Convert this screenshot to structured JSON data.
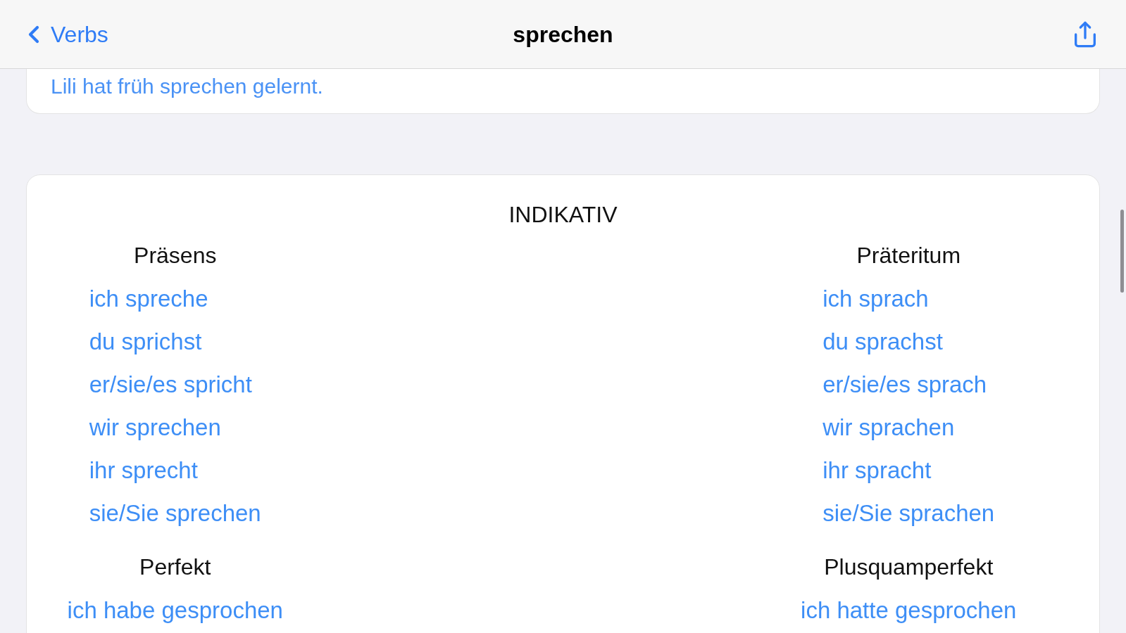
{
  "nav": {
    "back": "Verbs",
    "title": "sprechen"
  },
  "example": "Lili hat früh sprechen gelernt.",
  "section": {
    "title": "INDIKATIV",
    "columns": [
      {
        "groups": [
          {
            "title": "Präsens",
            "forms": [
              "ich spreche",
              "du sprichst",
              "er/sie/es spricht",
              "wir sprechen",
              "ihr sprecht",
              "sie/Sie sprechen"
            ]
          },
          {
            "title": "Perfekt",
            "forms": [
              "ich habe gesprochen"
            ]
          }
        ]
      },
      {
        "groups": [
          {
            "title": "Präteritum",
            "forms": [
              "ich sprach",
              "du sprachst",
              "er/sie/es sprach",
              "wir sprachen",
              "ihr spracht",
              "sie/Sie sprachen"
            ]
          },
          {
            "title": "Plusquamperfekt",
            "forms": [
              "ich hatte gesprochen"
            ]
          }
        ]
      }
    ]
  }
}
